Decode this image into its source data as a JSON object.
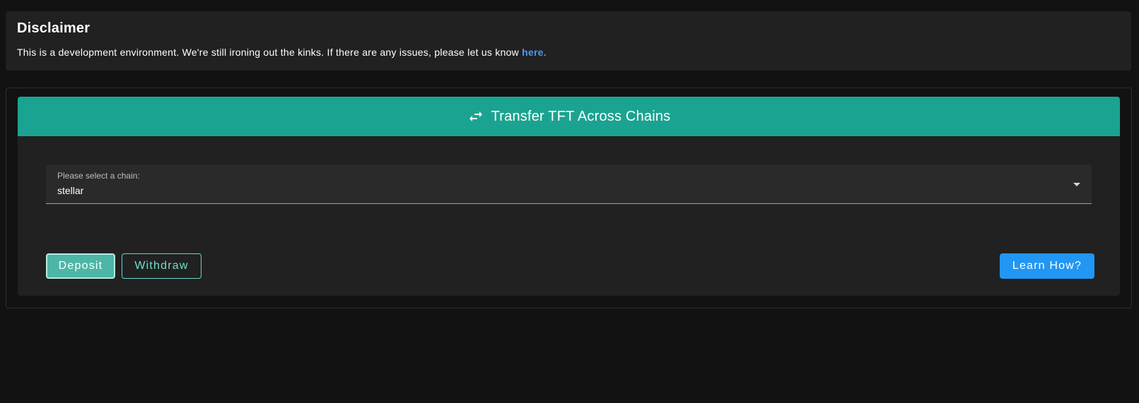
{
  "disclaimer": {
    "title": "Disclaimer",
    "message": "This is a development environment. We're still ironing out the kinks. If there are any issues, please let us know",
    "link_text": "here."
  },
  "transfer": {
    "header_icon": "swap-horizontal-icon",
    "header_title": "Transfer TFT Across Chains",
    "chain_select": {
      "label": "Please select a chain:",
      "value": "stellar",
      "dropdown_icon": "caret-down-icon"
    },
    "buttons": {
      "deposit": "Deposit",
      "withdraw": "Withdraw",
      "learn_how": "Learn How?"
    }
  },
  "colors": {
    "background": "#121212",
    "card": "#212121",
    "header_accent": "#1ba391",
    "link": "#4f96f2",
    "deposit_fill": "#4db6a6",
    "withdraw_outline": "#65d8c6",
    "learn_button": "#2196f3"
  }
}
